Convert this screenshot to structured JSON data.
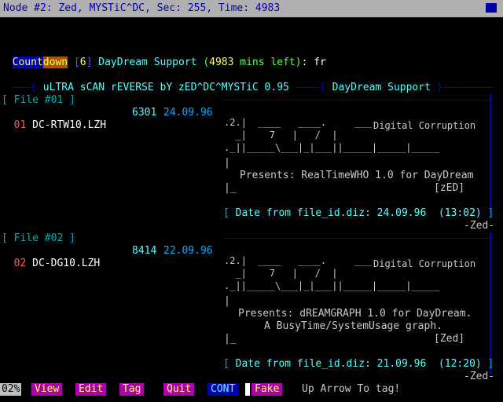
{
  "titlebar": {
    "text": "Node #2: Zed, MYSTiC^DC, Sec: 255, Time: 4983"
  },
  "prompt": {
    "count_a": "Count",
    "count_b": "down",
    "bracket_open": "[",
    "num": "6",
    "bracket_close": "]",
    "name": "DayDream Support",
    "paren_open": "(",
    "mins": "4983",
    "mins_label": "mins left",
    "paren_close": ")",
    "colon": ":",
    "input": "fr"
  },
  "header": {
    "left": "uLTRA sCAN rEVERSE bY zED^DC^MYSTiC 0.95",
    "right": "DayDream Support"
  },
  "files": [
    {
      "heading": "[ File #01 ]",
      "index": "01",
      "name": "DC-RTW10.LZH",
      "size": "6301",
      "date": "24.09.96",
      "logo_num": "2",
      "group": "Digital Corruption",
      "desc_lines": [
        "Presents: RealTimeWHO 1.0 for DayDream",
        "[zED]"
      ],
      "diz_line": "Date from file_id.diz: 24.09.96  (13:02)",
      "sig": "-Zed-"
    },
    {
      "heading": "[ File #02 ]",
      "index": "02",
      "name": "DC-DG10.LZH",
      "size": "8414",
      "date": "22.09.96",
      "logo_num": "2",
      "group": "Digital Corruption",
      "desc_lines": [
        "Presents: dREAMGRAPH 1.0 for DayDream.",
        "A BusyTime/SystemUsage graph.",
        "[Zed]"
      ],
      "diz_line": "Date from file_id.diz: 21.09.96  (12:20)",
      "sig": "-Zed-"
    }
  ],
  "bottombar": {
    "percent": "02%",
    "keys": [
      "View",
      "Edit",
      "Tag",
      "Quit",
      "CONT",
      "Fake"
    ],
    "hint": "Up Arrow To tag!"
  }
}
